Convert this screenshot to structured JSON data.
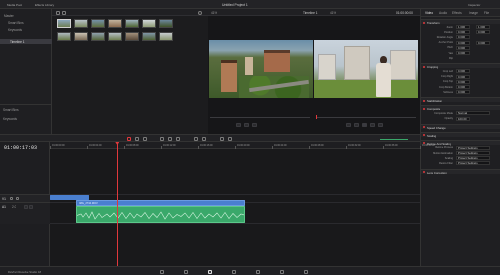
{
  "titlebar": {
    "app_name": "DaVinci Resolve Studio",
    "project_title": "Untitled Project 1",
    "menu": [
      "Media Pool",
      "Effects Library",
      "Edit Index",
      "Sound Library"
    ],
    "right_menu": [
      "Mixer",
      "Metadata",
      "Inspector"
    ]
  },
  "media_pool": {
    "bins": [
      "Master",
      "Smart Bins",
      "Keywords",
      "Collections"
    ],
    "selected_bin": "Timeline 1",
    "clips": [
      "",
      "",
      "",
      "",
      "",
      "",
      "",
      "",
      "",
      "",
      "",
      "",
      "",
      ""
    ]
  },
  "viewer": {
    "left_label": "Untitled Project 1",
    "left_zoom": "41%",
    "center_label": "Timeline 1",
    "right_zoom": "41%",
    "right_timecode": "01:00:00:00"
  },
  "sidebar_lower": {
    "items": [
      "Smart Bins",
      "Keywords"
    ]
  },
  "timeline": {
    "timecode": "01:00:17:03",
    "ruler": [
      "01:00:00:00",
      "01:00:04:00",
      "01:00:08:00",
      "01:00:12:00",
      "01:00:16:00",
      "01:00:20:00",
      "01:00:24:00",
      "01:00:28:00",
      "01:00:32:00",
      "01:00:36:00",
      "01:00:40:00"
    ],
    "tracks": [
      {
        "label": "V1",
        "name": "Video 1"
      },
      {
        "label": "A1",
        "name": "Audio 1",
        "level": "2.0"
      }
    ],
    "video_clip": "IMG_2734.MOV",
    "audio_clips": [
      "IMG_2734.MOV",
      "IMG_2735.MOV",
      "IMG_2736.MOV"
    ]
  },
  "inspector": {
    "tabs": [
      "Video",
      "Audio",
      "Effects",
      "Transition",
      "Image",
      "File"
    ],
    "sections": [
      {
        "title": "Transform",
        "rows": [
          {
            "label": "Zoom",
            "x": "1.000",
            "y": "1.000"
          },
          {
            "label": "Position",
            "x": "0.000",
            "y": "0.000"
          },
          {
            "label": "Rotation Angle",
            "x": "0.000",
            "y": ""
          },
          {
            "label": "Anchor Point",
            "x": "0.000",
            "y": "0.000"
          },
          {
            "label": "Pitch",
            "x": "0.000",
            "y": ""
          },
          {
            "label": "Yaw",
            "x": "0.000",
            "y": ""
          },
          {
            "label": "Flip",
            "x": "",
            "y": ""
          }
        ]
      },
      {
        "title": "Cropping",
        "rows": [
          {
            "label": "Crop Left",
            "x": "0.000",
            "y": ""
          },
          {
            "label": "Crop Right",
            "x": "0.000",
            "y": ""
          },
          {
            "label": "Crop Top",
            "x": "0.000",
            "y": ""
          },
          {
            "label": "Crop Bottom",
            "x": "0.000",
            "y": ""
          },
          {
            "label": "Softness",
            "x": "0.000",
            "y": ""
          }
        ]
      },
      {
        "title": "Stabilization",
        "rows": []
      },
      {
        "title": "Composite",
        "rows": [
          {
            "label": "Composite Mode",
            "x": "Normal",
            "y": ""
          },
          {
            "label": "Opacity",
            "x": "100.00",
            "y": ""
          }
        ]
      },
      {
        "title": "Speed Change",
        "rows": []
      },
      {
        "title": "Scaling",
        "rows": []
      },
      {
        "title": "Retime And Scaling",
        "rows": [
          {
            "label": "Retime Process",
            "x": "Project Settings",
            "y": ""
          },
          {
            "label": "Motion Estimation",
            "x": "Project Settings",
            "y": ""
          },
          {
            "label": "Scaling",
            "x": "Project Settings",
            "y": ""
          },
          {
            "label": "Resize Filter",
            "x": "Project Settings",
            "y": ""
          }
        ]
      },
      {
        "title": "Lens Correction",
        "rows": []
      }
    ]
  },
  "bottom_bar": {
    "app": "DaVinci Resolve Studio 18",
    "pages": [
      "Media",
      "Cut",
      "Edit",
      "Fusion",
      "Color",
      "Fairlight",
      "Deliver"
    ]
  },
  "colors": {
    "video_clip": "#4a7fcf",
    "audio_clip": "#3aa86a",
    "playhead": "#e0383c",
    "accent": "#e0383c"
  }
}
